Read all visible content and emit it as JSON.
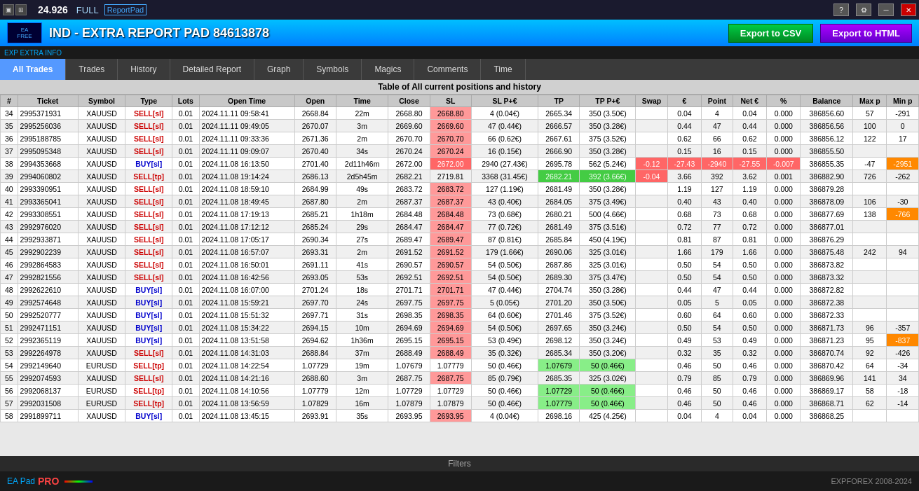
{
  "titleBar": {
    "price": "24.926",
    "mode": "FULL",
    "logo": "ReportPad"
  },
  "header": {
    "title": "IND - EXTRA REPORT PAD 84613878",
    "exportCsvLabel": "Export to CSV",
    "exportHtmlLabel": "Export to HTML"
  },
  "extraInfo": {
    "label": "EXP EXTRA INFO"
  },
  "tabs": [
    {
      "label": "All Trades",
      "active": true
    },
    {
      "label": "Trades",
      "active": false
    },
    {
      "label": "History",
      "active": false
    },
    {
      "label": "Detailed Report",
      "active": false
    },
    {
      "label": "Graph",
      "active": false
    },
    {
      "label": "Symbols",
      "active": false
    },
    {
      "label": "Magics",
      "active": false
    },
    {
      "label": "Comments",
      "active": false
    },
    {
      "label": "Time",
      "active": false
    }
  ],
  "tableTitle": "Table of All current positions and history",
  "columns": [
    "#",
    "Ticket",
    "Symbol",
    "Type",
    "Lots",
    "Open Time",
    "Open",
    "Time",
    "Close",
    "SL",
    "SL P+€",
    "TP",
    "TP P+€",
    "Swap",
    "€",
    "Point",
    "Net €",
    "%",
    "Balance",
    "Max p",
    "Min p"
  ],
  "rows": [
    {
      "num": 34,
      "ticket": "2995371931",
      "symbol": "XAUUSD",
      "type": "SELL[sl]",
      "lots": "0.01",
      "openTime": "2024.11.11 09:58:41",
      "open": "2668.84",
      "time": "22m",
      "close": "2668.80",
      "sl": "2668.80",
      "slpe": "4 (0.04€)",
      "tp": "2665.34",
      "tppe": "350 (3.50€)",
      "swap": "",
      "eur": "0.04",
      "point": "4",
      "neteur": "0.04",
      "pct": "0.000",
      "balance": "386856.60",
      "maxp": "57",
      "minp": "-291",
      "slClass": "sell-sl",
      "tpClass": ""
    },
    {
      "num": 35,
      "ticket": "2995256036",
      "symbol": "XAUUSD",
      "type": "SELL[sl]",
      "lots": "0.01",
      "openTime": "2024.11.11 09:49:05",
      "open": "2670.07",
      "time": "3m",
      "close": "2669.60",
      "sl": "2669.60",
      "slpe": "47 (0.44€)",
      "tp": "2666.57",
      "tppe": "350 (3.28€)",
      "swap": "",
      "eur": "0.44",
      "point": "47",
      "neteur": "0.44",
      "pct": "0.000",
      "balance": "386856.56",
      "maxp": "100",
      "minp": "0",
      "slClass": "sell-sl",
      "tpClass": ""
    },
    {
      "num": 36,
      "ticket": "2995188785",
      "symbol": "XAUUSD",
      "type": "SELL[sl]",
      "lots": "0.01",
      "openTime": "2024.11.11 09:33:36",
      "open": "2671.36",
      "time": "2m",
      "close": "2670.70",
      "sl": "2670.70",
      "slpe": "66 (0.62€)",
      "tp": "2667.61",
      "tppe": "375 (3.52€)",
      "swap": "",
      "eur": "0.62",
      "point": "66",
      "neteur": "0.62",
      "pct": "0.000",
      "balance": "386856.12",
      "maxp": "122",
      "minp": "17",
      "slClass": "sell-sl",
      "tpClass": ""
    },
    {
      "num": 37,
      "ticket": "2995095348",
      "symbol": "XAUUSD",
      "type": "SELL[sl]",
      "lots": "0.01",
      "openTime": "2024.11.11 09:09:07",
      "open": "2670.40",
      "time": "34s",
      "close": "2670.24",
      "sl": "2670.24",
      "slpe": "16 (0.15€)",
      "tp": "2666.90",
      "tppe": "350 (3.28€)",
      "swap": "",
      "eur": "0.15",
      "point": "16",
      "neteur": "0.15",
      "pct": "0.000",
      "balance": "386855.50",
      "maxp": "",
      "minp": "",
      "slClass": "sell-sl",
      "tpClass": ""
    },
    {
      "num": 38,
      "ticket": "2994353668",
      "symbol": "XAUUSD",
      "type": "BUY[sl]",
      "lots": "0.01",
      "openTime": "2024.11.08 16:13:50",
      "open": "2701.40",
      "time": "2d11h46m",
      "close": "2672.00",
      "sl": "2672.00",
      "slpe": "2940 (27.43€)",
      "tp": "2695.78",
      "tppe": "562 (5.24€)",
      "swap": "-0.12",
      "eur": "-27.43",
      "point": "-2940",
      "neteur": "-27.55",
      "pct": "-0.007",
      "balance": "386855.35",
      "maxp": "-47",
      "minp": "-2951",
      "slClass": "red-cell",
      "tpClass": "",
      "buyClass": "buy-sl"
    },
    {
      "num": 39,
      "ticket": "2994060802",
      "symbol": "XAUUSD",
      "type": "SELL[tp]",
      "lots": "0.01",
      "openTime": "2024.11.08 19:14:24",
      "open": "2686.13",
      "time": "2d5h45m",
      "close": "2682.21",
      "sl": "2719.81",
      "slpe": "3368 (31.45€)",
      "tp": "2682.21",
      "tppe": "392 (3.66€)",
      "swap": "-0.04",
      "eur": "3.66",
      "point": "392",
      "neteur": "3.62",
      "pct": "0.001",
      "balance": "386882.90",
      "maxp": "726",
      "minp": "-262",
      "slClass": "",
      "tpClass": "highlight-green"
    },
    {
      "num": 40,
      "ticket": "2993390951",
      "symbol": "XAUUSD",
      "type": "SELL[sl]",
      "lots": "0.01",
      "openTime": "2024.11.08 18:59:10",
      "open": "2684.99",
      "time": "49s",
      "close": "2683.72",
      "sl": "2683.72",
      "slpe": "127 (1.19€)",
      "tp": "2681.49",
      "tppe": "350 (3.28€)",
      "swap": "",
      "eur": "1.19",
      "point": "127",
      "neteur": "1.19",
      "pct": "0.000",
      "balance": "386879.28",
      "maxp": "",
      "minp": "",
      "slClass": "sell-sl",
      "tpClass": ""
    },
    {
      "num": 41,
      "ticket": "2993365041",
      "symbol": "XAUUSD",
      "type": "SELL[sl]",
      "lots": "0.01",
      "openTime": "2024.11.08 18:49:45",
      "open": "2687.80",
      "time": "2m",
      "close": "2687.37",
      "sl": "2687.37",
      "slpe": "43 (0.40€)",
      "tp": "2684.05",
      "tppe": "375 (3.49€)",
      "swap": "",
      "eur": "0.40",
      "point": "43",
      "neteur": "0.40",
      "pct": "0.000",
      "balance": "386878.09",
      "maxp": "106",
      "minp": "-30",
      "slClass": "sell-sl",
      "tpClass": ""
    },
    {
      "num": 42,
      "ticket": "2993308551",
      "symbol": "XAUUSD",
      "type": "SELL[sl]",
      "lots": "0.01",
      "openTime": "2024.11.08 17:19:13",
      "open": "2685.21",
      "time": "1h18m",
      "close": "2684.48",
      "sl": "2684.48",
      "slpe": "73 (0.68€)",
      "tp": "2680.21",
      "tppe": "500 (4.66€)",
      "swap": "",
      "eur": "0.68",
      "point": "73",
      "neteur": "0.68",
      "pct": "0.000",
      "balance": "386877.69",
      "maxp": "138",
      "minp": "-766",
      "slClass": "sell-sl",
      "tpClass": ""
    },
    {
      "num": 43,
      "ticket": "2992976020",
      "symbol": "XAUUSD",
      "type": "SELL[sl]",
      "lots": "0.01",
      "openTime": "2024.11.08 17:12:12",
      "open": "2685.24",
      "time": "29s",
      "close": "2684.47",
      "sl": "2684.47",
      "slpe": "77 (0.72€)",
      "tp": "2681.49",
      "tppe": "375 (3.51€)",
      "swap": "",
      "eur": "0.72",
      "point": "77",
      "neteur": "0.72",
      "pct": "0.000",
      "balance": "386877.01",
      "maxp": "",
      "minp": "",
      "slClass": "sell-sl",
      "tpClass": ""
    },
    {
      "num": 44,
      "ticket": "2992933871",
      "symbol": "XAUUSD",
      "type": "SELL[sl]",
      "lots": "0.01",
      "openTime": "2024.11.08 17:05:17",
      "open": "2690.34",
      "time": "27s",
      "close": "2689.47",
      "sl": "2689.47",
      "slpe": "87 (0.81€)",
      "tp": "2685.84",
      "tppe": "450 (4.19€)",
      "swap": "",
      "eur": "0.81",
      "point": "87",
      "neteur": "0.81",
      "pct": "0.000",
      "balance": "386876.29",
      "maxp": "",
      "minp": "",
      "slClass": "sell-sl",
      "tpClass": ""
    },
    {
      "num": 45,
      "ticket": "2992902239",
      "symbol": "XAUUSD",
      "type": "SELL[sl]",
      "lots": "0.01",
      "openTime": "2024.11.08 16:57:07",
      "open": "2693.31",
      "time": "2m",
      "close": "2691.52",
      "sl": "2691.52",
      "slpe": "179 (1.66€)",
      "tp": "2690.06",
      "tppe": "325 (3.01€)",
      "swap": "",
      "eur": "1.66",
      "point": "179",
      "neteur": "1.66",
      "pct": "0.000",
      "balance": "386875.48",
      "maxp": "242",
      "minp": "94",
      "slClass": "sell-sl",
      "tpClass": ""
    },
    {
      "num": 46,
      "ticket": "2992864583",
      "symbol": "XAUUSD",
      "type": "SELL[sl]",
      "lots": "0.01",
      "openTime": "2024.11.08 16:50:01",
      "open": "2691.11",
      "time": "41s",
      "close": "2690.57",
      "sl": "2690.57",
      "slpe": "54 (0.50€)",
      "tp": "2687.86",
      "tppe": "325 (3.01€)",
      "swap": "",
      "eur": "0.50",
      "point": "54",
      "neteur": "0.50",
      "pct": "0.000",
      "balance": "386873.82",
      "maxp": "",
      "minp": "",
      "slClass": "sell-sl",
      "tpClass": ""
    },
    {
      "num": 47,
      "ticket": "2992821556",
      "symbol": "XAUUSD",
      "type": "SELL[sl]",
      "lots": "0.01",
      "openTime": "2024.11.08 16:42:56",
      "open": "2693.05",
      "time": "53s",
      "close": "2692.51",
      "sl": "2692.51",
      "slpe": "54 (0.50€)",
      "tp": "2689.30",
      "tppe": "375 (3.47€)",
      "swap": "",
      "eur": "0.50",
      "point": "54",
      "neteur": "0.50",
      "pct": "0.000",
      "balance": "386873.32",
      "maxp": "",
      "minp": "",
      "slClass": "sell-sl",
      "tpClass": ""
    },
    {
      "num": 48,
      "ticket": "2992622610",
      "symbol": "XAUUSD",
      "type": "BUY[sl]",
      "lots": "0.01",
      "openTime": "2024.11.08 16:07:00",
      "open": "2701.24",
      "time": "18s",
      "close": "2701.71",
      "sl": "2701.71",
      "slpe": "47 (0.44€)",
      "tp": "2704.74",
      "tppe": "350 (3.28€)",
      "swap": "",
      "eur": "0.44",
      "point": "47",
      "neteur": "0.44",
      "pct": "0.000",
      "balance": "386872.82",
      "maxp": "",
      "minp": "",
      "slClass": "sell-sl",
      "tpClass": ""
    },
    {
      "num": 49,
      "ticket": "2992574648",
      "symbol": "XAUUSD",
      "type": "BUY[sl]",
      "lots": "0.01",
      "openTime": "2024.11.08 15:59:21",
      "open": "2697.70",
      "time": "24s",
      "close": "2697.75",
      "sl": "2697.75",
      "slpe": "5 (0.05€)",
      "tp": "2701.20",
      "tppe": "350 (3.50€)",
      "swap": "",
      "eur": "0.05",
      "point": "5",
      "neteur": "0.05",
      "pct": "0.000",
      "balance": "386872.38",
      "maxp": "",
      "minp": "",
      "slClass": "sell-sl",
      "tpClass": ""
    },
    {
      "num": 50,
      "ticket": "2992520777",
      "symbol": "XAUUSD",
      "type": "BUY[sl]",
      "lots": "0.01",
      "openTime": "2024.11.08 15:51:32",
      "open": "2697.71",
      "time": "31s",
      "close": "2698.35",
      "sl": "2698.35",
      "slpe": "64 (0.60€)",
      "tp": "2701.46",
      "tppe": "375 (3.52€)",
      "swap": "",
      "eur": "0.60",
      "point": "64",
      "neteur": "0.60",
      "pct": "0.000",
      "balance": "386872.33",
      "maxp": "",
      "minp": "",
      "slClass": "sell-sl",
      "tpClass": ""
    },
    {
      "num": 51,
      "ticket": "2992471151",
      "symbol": "XAUUSD",
      "type": "BUY[sl]",
      "lots": "0.01",
      "openTime": "2024.11.08 15:34:22",
      "open": "2694.15",
      "time": "10m",
      "close": "2694.69",
      "sl": "2694.69",
      "slpe": "54 (0.50€)",
      "tp": "2697.65",
      "tppe": "350 (3.24€)",
      "swap": "",
      "eur": "0.50",
      "point": "54",
      "neteur": "0.50",
      "pct": "0.000",
      "balance": "386871.73",
      "maxp": "96",
      "minp": "-357",
      "slClass": "sell-sl",
      "tpClass": ""
    },
    {
      "num": 52,
      "ticket": "2992365119",
      "symbol": "XAUUSD",
      "type": "BUY[sl]",
      "lots": "0.01",
      "openTime": "2024.11.08 13:51:58",
      "open": "2694.62",
      "time": "1h36m",
      "close": "2695.15",
      "sl": "2695.15",
      "slpe": "53 (0.49€)",
      "tp": "2698.12",
      "tppe": "350 (3.24€)",
      "swap": "",
      "eur": "0.49",
      "point": "53",
      "neteur": "0.49",
      "pct": "0.000",
      "balance": "386871.23",
      "maxp": "95",
      "minp": "-837",
      "slClass": "sell-sl",
      "tpClass": ""
    },
    {
      "num": 53,
      "ticket": "2992264978",
      "symbol": "XAUUSD",
      "type": "SELL[sl]",
      "lots": "0.01",
      "openTime": "2024.11.08 14:31:03",
      "open": "2688.84",
      "time": "37m",
      "close": "2688.49",
      "sl": "2688.49",
      "slpe": "35 (0.32€)",
      "tp": "2685.34",
      "tppe": "350 (3.20€)",
      "swap": "",
      "eur": "0.32",
      "point": "35",
      "neteur": "0.32",
      "pct": "0.000",
      "balance": "386870.74",
      "maxp": "92",
      "minp": "-426",
      "slClass": "sell-sl",
      "tpClass": ""
    },
    {
      "num": 54,
      "ticket": "2992149640",
      "symbol": "EURUSD",
      "type": "SELL[tp]",
      "lots": "0.01",
      "openTime": "2024.11.08 14:22:54",
      "open": "1.07729",
      "time": "19m",
      "close": "1.07679",
      "sl": "1.07779",
      "slpe": "50 (0.46€)",
      "tp": "1.07679",
      "tppe": "50 (0.46€)",
      "swap": "",
      "eur": "0.46",
      "point": "50",
      "neteur": "0.46",
      "pct": "0.000",
      "balance": "386870.42",
      "maxp": "64",
      "minp": "-34",
      "slClass": "",
      "tpClass": "highlight-tpgreen"
    },
    {
      "num": 55,
      "ticket": "2992074593",
      "symbol": "XAUUSD",
      "type": "SELL[sl]",
      "lots": "0.01",
      "openTime": "2024.11.08 14:21:16",
      "open": "2688.60",
      "time": "3m",
      "close": "2687.75",
      "sl": "2687.75",
      "slpe": "85 (0.79€)",
      "tp": "2685.35",
      "tppe": "325 (3.02€)",
      "swap": "",
      "eur": "0.79",
      "point": "85",
      "neteur": "0.79",
      "pct": "0.000",
      "balance": "386869.96",
      "maxp": "141",
      "minp": "34",
      "slClass": "sell-sl",
      "tpClass": ""
    },
    {
      "num": 56,
      "ticket": "2992068137",
      "symbol": "EURUSD",
      "type": "SELL[tp]",
      "lots": "0.01",
      "openTime": "2024.11.08 14:10:56",
      "open": "1.07779",
      "time": "12m",
      "close": "1.07729",
      "sl": "1.07729",
      "slpe": "50 (0.46€)",
      "tp": "1.07729",
      "tppe": "50 (0.46€)",
      "swap": "",
      "eur": "0.46",
      "point": "50",
      "neteur": "0.46",
      "pct": "0.000",
      "balance": "386869.17",
      "maxp": "58",
      "minp": "-18",
      "slClass": "",
      "tpClass": "highlight-tpgreen"
    },
    {
      "num": 57,
      "ticket": "2992031508",
      "symbol": "EURUSD",
      "type": "SELL[tp]",
      "lots": "0.01",
      "openTime": "2024.11.08 13:56:59",
      "open": "1.07829",
      "time": "16m",
      "close": "1.07879",
      "sl": "1.07879",
      "slpe": "50 (0.46€)",
      "tp": "1.07779",
      "tppe": "50 (0.46€)",
      "swap": "",
      "eur": "0.46",
      "point": "50",
      "neteur": "0.46",
      "pct": "0.000",
      "balance": "386868.71",
      "maxp": "62",
      "minp": "-14",
      "slClass": "",
      "tpClass": "highlight-tpgreen"
    },
    {
      "num": 58,
      "ticket": "2991899711",
      "symbol": "XAUUSD",
      "type": "BUY[sl]",
      "lots": "0.01",
      "openTime": "2024.11.08 13:45:15",
      "open": "2693.91",
      "time": "35s",
      "close": "2693.95",
      "sl": "2693.95",
      "slpe": "4 (0.04€)",
      "tp": "2698.16",
      "tppe": "425 (4.25€)",
      "swap": "",
      "eur": "0.04",
      "point": "4",
      "neteur": "0.04",
      "pct": "0.000",
      "balance": "386868.25",
      "maxp": "",
      "minp": "",
      "slClass": "sell-sl",
      "tpClass": ""
    }
  ],
  "filters": {
    "label": "Filters"
  },
  "footer": {
    "eaLabel": "EA Pad",
    "proLabel": "PRO",
    "copyright": "EXPFOREX 2008-2024"
  }
}
